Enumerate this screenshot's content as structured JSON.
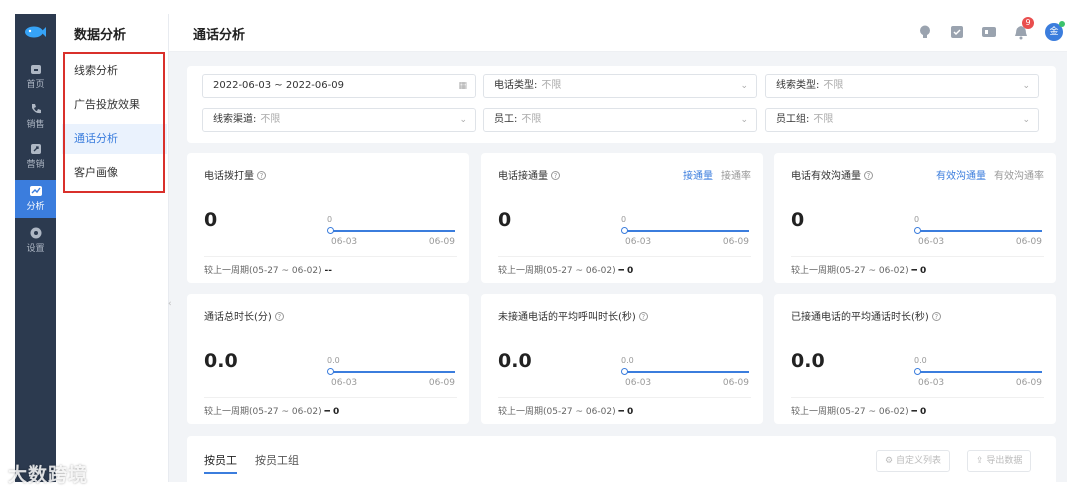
{
  "rail": {
    "items": [
      {
        "label": "首页",
        "icon": "home-icon"
      },
      {
        "label": "销售",
        "icon": "phone-icon"
      },
      {
        "label": "营销",
        "icon": "marketing-icon"
      },
      {
        "label": "分析",
        "icon": "chart-icon"
      },
      {
        "label": "设置",
        "icon": "settings-icon"
      }
    ],
    "active_index": 3
  },
  "subnav": {
    "title": "数据分析",
    "items": [
      {
        "label": "线索分析"
      },
      {
        "label": "广告投放效果"
      },
      {
        "label": "通话分析"
      },
      {
        "label": "客户画像"
      }
    ],
    "active_index": 2
  },
  "header": {
    "title": "通话分析",
    "notification_count": "9",
    "avatar_text": "金",
    "icons": [
      "bulb-icon",
      "task-icon",
      "screen-icon",
      "bell-icon",
      "avatar"
    ]
  },
  "filters": {
    "date_range": "2022-06-03 ~ 2022-06-09",
    "call_type": {
      "label": "电话类型:",
      "value": "不限"
    },
    "lead_type": {
      "label": "线索类型:",
      "value": "不限"
    },
    "lead_channel": {
      "label": "线索渠道:",
      "value": "不限"
    },
    "employee": {
      "label": "员工:",
      "value": "不限"
    },
    "employee_group": {
      "label": "员工组:",
      "value": "不限"
    }
  },
  "cards": [
    {
      "title": "电话拨打量",
      "value": "0",
      "spark_zero": "0",
      "start": "06-03",
      "end": "06-09",
      "compare_label": "较上一周期(05-27 ~ 06-02)",
      "compare_value": "--"
    },
    {
      "title": "电话接通量",
      "value": "0",
      "spark_zero": "0",
      "start": "06-03",
      "end": "06-09",
      "compare_label": "较上一周期(05-27 ~ 06-02)",
      "compare_value": "━ 0",
      "tab_on": "接通量",
      "tab_off": "接通率"
    },
    {
      "title": "电话有效沟通量",
      "value": "0",
      "spark_zero": "0",
      "start": "06-03",
      "end": "06-09",
      "compare_label": "较上一周期(05-27 ~ 06-02)",
      "compare_value": "━ 0",
      "tab_on": "有效沟通量",
      "tab_off": "有效沟通率"
    },
    {
      "title": "通话总时长(分)",
      "value": "0.0",
      "spark_zero": "0.0",
      "start": "06-03",
      "end": "06-09",
      "compare_label": "较上一周期(05-27 ~ 06-02)",
      "compare_value": "━ 0"
    },
    {
      "title": "未接通电话的平均呼叫时长(秒)",
      "value": "0.0",
      "spark_zero": "0.0",
      "start": "06-03",
      "end": "06-09",
      "compare_label": "较上一周期(05-27 ~ 06-02)",
      "compare_value": "━ 0"
    },
    {
      "title": "已接通电话的平均通话时长(秒)",
      "value": "0.0",
      "spark_zero": "0.0",
      "start": "06-03",
      "end": "06-09",
      "compare_label": "较上一周期(05-27 ~ 06-02)",
      "compare_value": "━ 0"
    }
  ],
  "bottom": {
    "tab_employee": "按员工",
    "tab_group": "按员工组",
    "custom_columns": "自定义列表",
    "export": "导出数据"
  },
  "watermark": "大数跨境",
  "colors": {
    "accent": "#3b7ddd",
    "rail_bg": "#2c3a4f",
    "highlight_border": "#d9302b",
    "badge": "#e94e4e"
  }
}
